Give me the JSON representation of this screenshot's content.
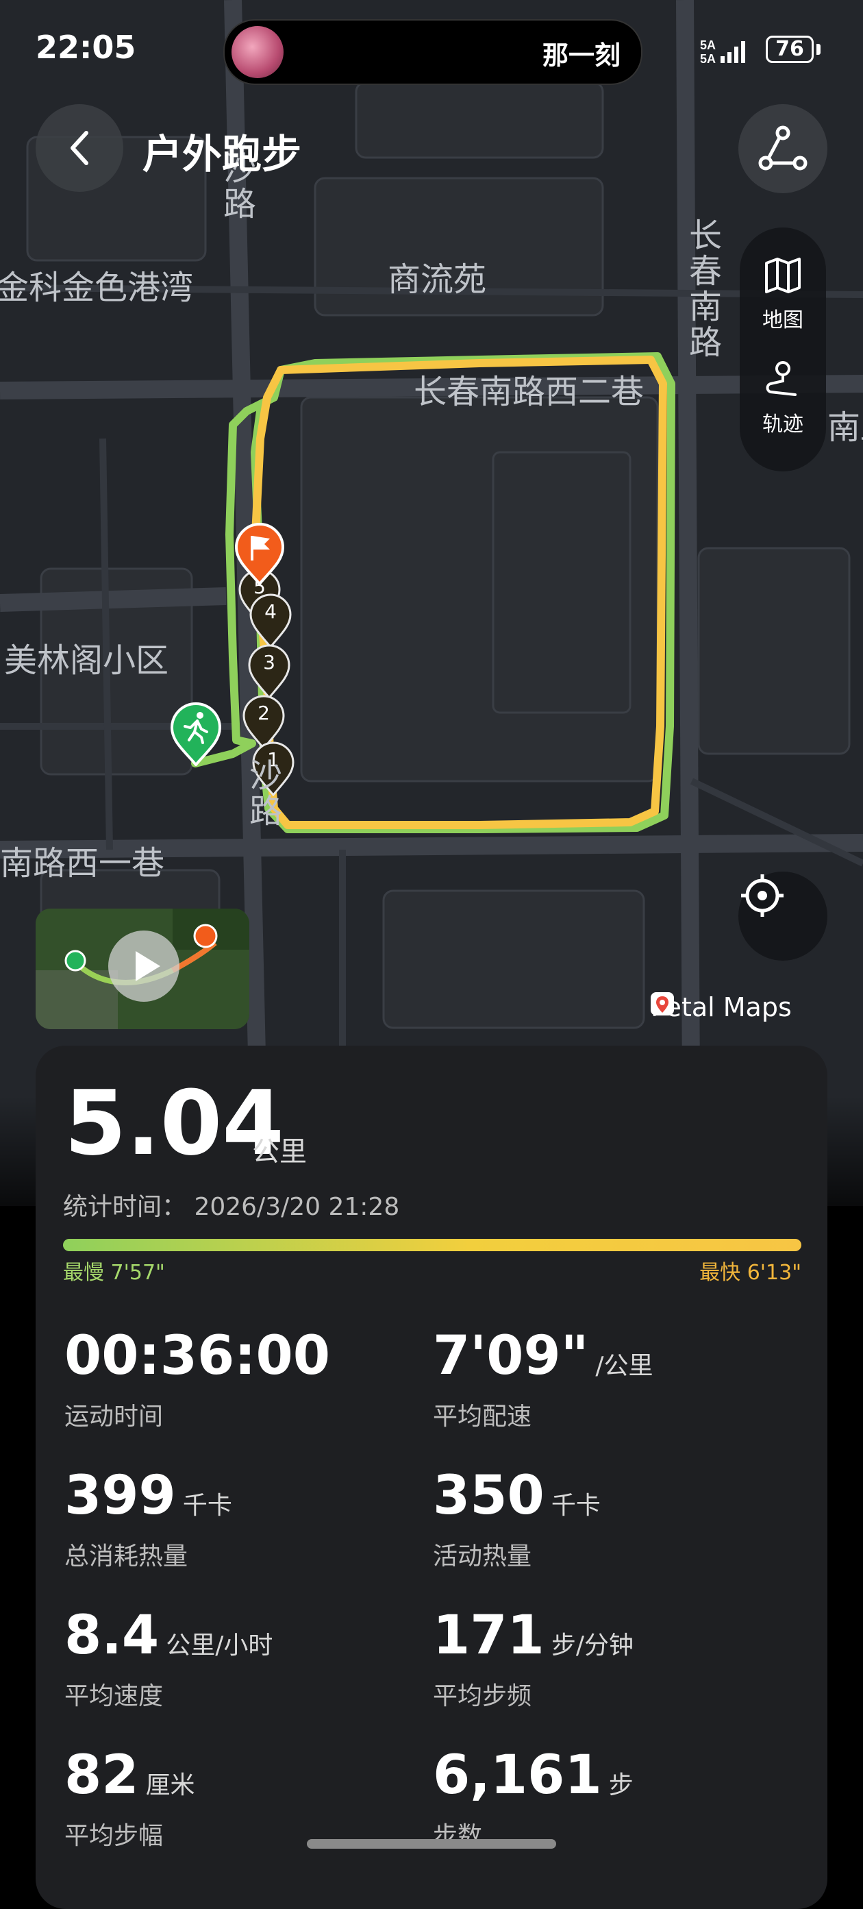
{
  "status_bar": {
    "time": "22:05",
    "island_text": "那一刻",
    "signal_label": "5A",
    "battery": "76"
  },
  "header": {
    "title": "户外跑步"
  },
  "map": {
    "labels": {
      "road_sha": "沙路",
      "place_jinke": "金科金色港湾",
      "place_shangliu": "商流苑",
      "road_changchun": "长春南路",
      "road_changchun_west2": "长春南路西二巷",
      "road_nan_right": "南路",
      "place_meilin": "美林阁小区",
      "road_sha_lower": "沙路",
      "road_west1": "南路西一巷"
    },
    "side_panel": {
      "map_label": "地图",
      "track_label": "轨迹"
    },
    "markers": [
      "1",
      "2",
      "3",
      "4",
      "5"
    ],
    "brand": "Petal Maps",
    "colors": {
      "route_slow": "#8fd05b",
      "route_fast": "#f7c544",
      "start_pin": "#22b35a",
      "end_pin": "#f25c1b"
    }
  },
  "summary": {
    "distance": "5.04",
    "distance_unit": "公里",
    "record_time": "统计时间：  2026/3/20 21:28",
    "pace_slow": "最慢 7'57\"",
    "pace_fast": "最快 6'13\""
  },
  "metrics": [
    {
      "value": "00:36:00",
      "unit": "",
      "label": "运动时间"
    },
    {
      "value": "7'09\"",
      "unit": "/公里",
      "label": "平均配速"
    },
    {
      "value": "399",
      "unit": "千卡",
      "label": "总消耗热量"
    },
    {
      "value": "350",
      "unit": "千卡",
      "label": "活动热量"
    },
    {
      "value": "8.4",
      "unit": "公里/小时",
      "label": "平均速度"
    },
    {
      "value": "171",
      "unit": "步/分钟",
      "label": "平均步频"
    },
    {
      "value": "82",
      "unit": "厘米",
      "label": "平均步幅"
    },
    {
      "value": "6,161",
      "unit": "步",
      "label": "步数"
    }
  ]
}
